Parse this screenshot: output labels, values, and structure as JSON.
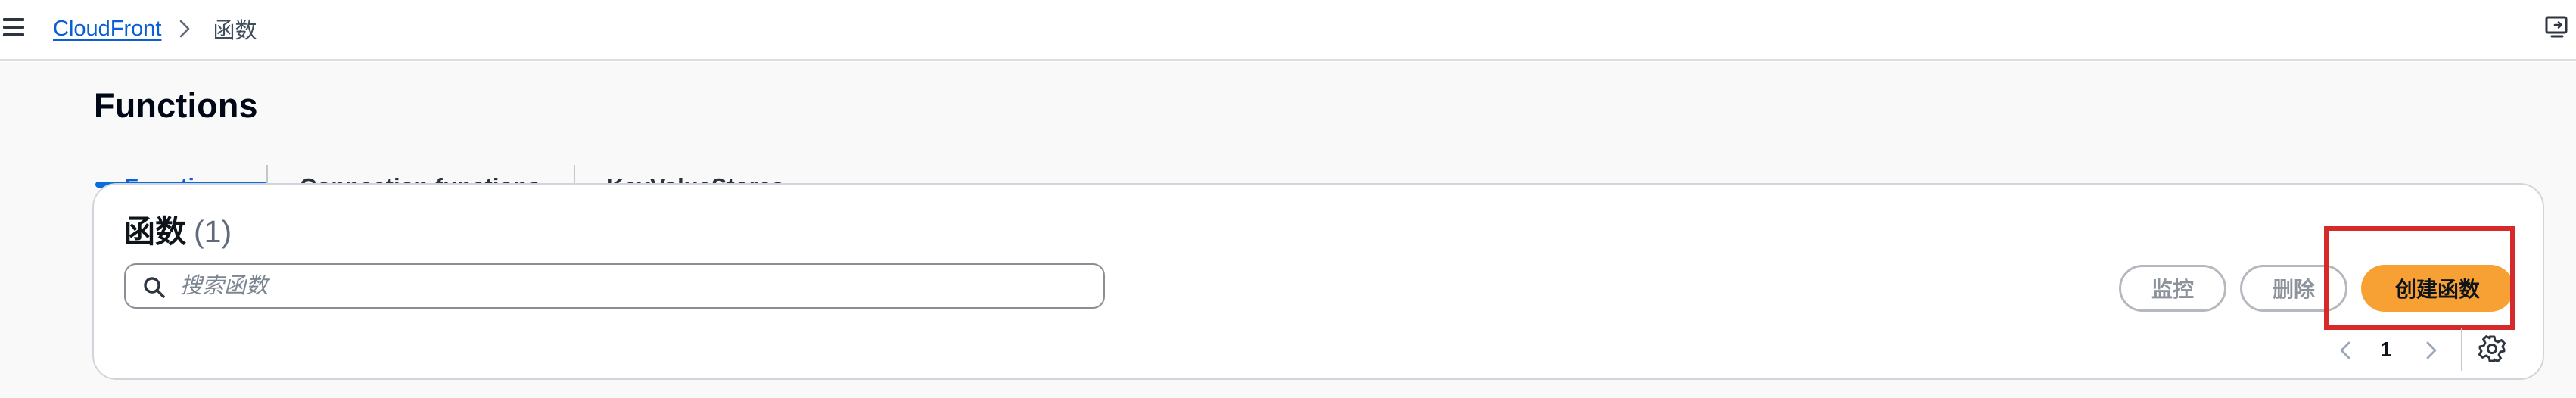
{
  "topbar": {
    "menu_icon": "hamburger-menu-icon",
    "breadcrumb": {
      "root": "CloudFront",
      "separator_icon": "chevron-right-icon",
      "current": "函数"
    },
    "right_icon": "screen-share-icon"
  },
  "page": {
    "title": "Functions"
  },
  "tabs": [
    {
      "label": "Functions",
      "active": true
    },
    {
      "label": "Connection functions",
      "active": false
    },
    {
      "label": "KeyValueStores",
      "active": false
    }
  ],
  "panel": {
    "title": "函数",
    "count": "(1)",
    "search": {
      "placeholder": "搜索函数",
      "value": "",
      "icon": "search-icon"
    },
    "actions": {
      "monitor_label": "监控",
      "delete_label": "删除",
      "create_label": "创建函数"
    },
    "pagination": {
      "current_page": "1",
      "prev_icon": "chevron-left-icon",
      "next_icon": "chevron-right-icon"
    },
    "settings_icon": "gear-icon"
  },
  "colors": {
    "link": "#0a5fd4",
    "active_tab": "#0a5fd4",
    "primary_button": "#f7a034",
    "highlight_box": "#d62a2a"
  }
}
